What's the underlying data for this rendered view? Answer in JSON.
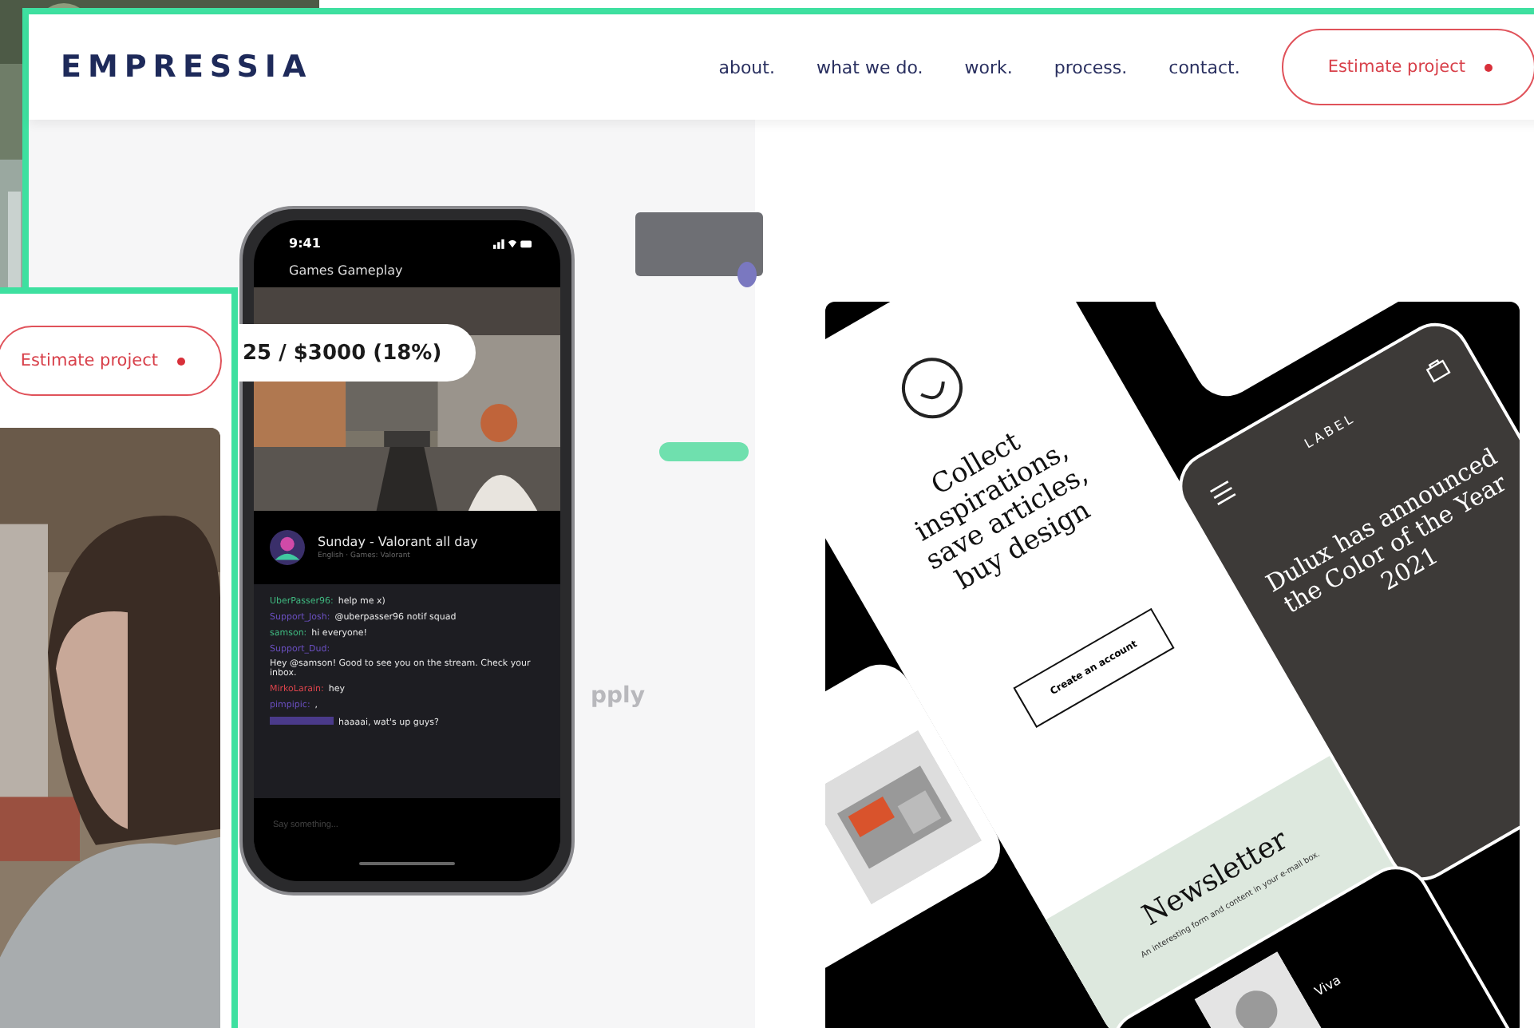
{
  "header": {
    "logo": "EMPRESSIA",
    "nav": [
      {
        "label": "about."
      },
      {
        "label": "what we do."
      },
      {
        "label": "work."
      },
      {
        "label": "process."
      },
      {
        "label": "contact."
      }
    ],
    "cta": {
      "label": "Estimate project"
    }
  },
  "phone": {
    "time": "9:41",
    "title": "Games Gameplay",
    "stream": {
      "title": "Sunday - Valorant all day",
      "subtitle": "English · Games: Valorant"
    },
    "chat": [
      {
        "user": "UberPasser96:",
        "color": "#3fb77f",
        "text": "help me x)"
      },
      {
        "user": "Support_Josh:",
        "color": "#6a4fc0",
        "text": "@uberpasser96 notif squad"
      },
      {
        "user": "samson:",
        "color": "#3fb77f",
        "text": "hi everyone!"
      },
      {
        "user": "Support_Dud:",
        "color": "#6a4fc0",
        "text": "Hey @samson! Good to see you on the stream. Check your inbox."
      },
      {
        "user": "MirkoLarain:",
        "color": "#d9434b",
        "text": "hey"
      },
      {
        "user": "pimpipic:",
        "color": "#6a4fc0",
        "text": ","
      },
      {
        "color": "#4a3a8a",
        "text": "haaaai, wat's up guys?"
      }
    ],
    "input": {
      "placeholder": "Say something..."
    }
  },
  "backdrop_mockup": {
    "heading": "pply"
  },
  "design_showcase": {
    "app_card": {
      "heading": "Collect inspirations, save articles, buy design",
      "button": "Create an account",
      "newsletter_title": "Newsletter",
      "newsletter_text": "An interesting form and content in your e-mail box."
    },
    "article_card": {
      "logo": "LABEL",
      "heading": "Dulux has announced the Color of the Year 2021"
    },
    "bottom_card": {
      "label": "Viva"
    }
  },
  "overlay_window": {
    "cta": {
      "label": "Estimate project"
    }
  },
  "goal_badge": {
    "text": "25 / $3000 (18%)"
  }
}
